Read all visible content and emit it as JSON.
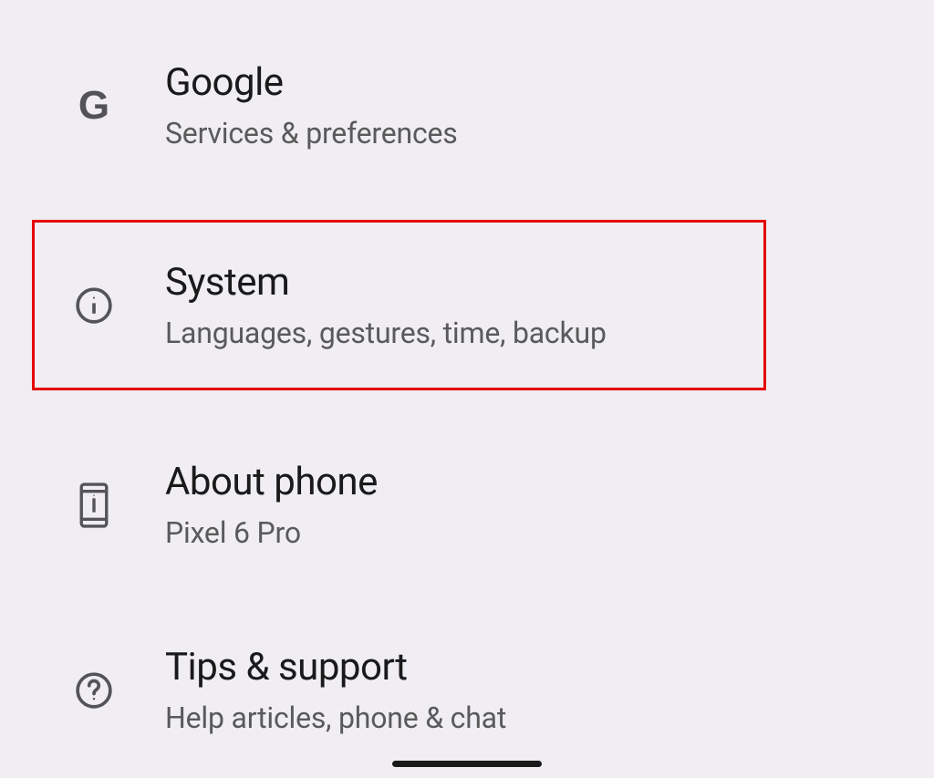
{
  "settings": {
    "items": [
      {
        "title": "Google",
        "subtitle": "Services & preferences",
        "icon": "google-g-icon"
      },
      {
        "title": "System",
        "subtitle": "Languages, gestures, time, backup",
        "icon": "info-icon"
      },
      {
        "title": "About phone",
        "subtitle": "Pixel 6 Pro",
        "icon": "phone-icon"
      },
      {
        "title": "Tips & support",
        "subtitle": "Help articles, phone & chat",
        "icon": "help-icon"
      }
    ]
  },
  "highlight": {
    "color": "#e60000"
  }
}
